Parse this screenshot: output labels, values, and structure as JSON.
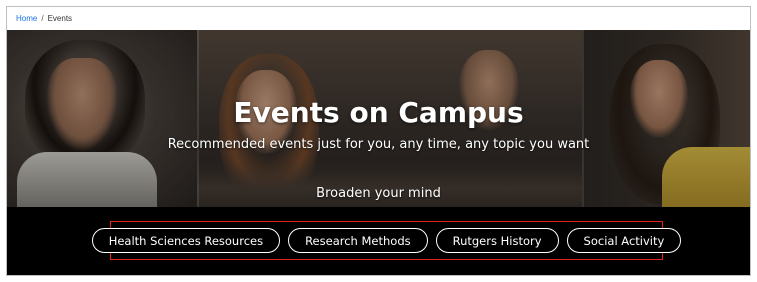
{
  "breadcrumb": {
    "home": "Home",
    "separator": "/",
    "current": "Events"
  },
  "hero": {
    "title": "Events on Campus",
    "subtitle": "Recommended events just for you, any time, any topic you want",
    "tagline": "Broaden your mind"
  },
  "topics": [
    {
      "label": "Health Sciences Resources"
    },
    {
      "label": "Research Methods"
    },
    {
      "label": "Rutgers History"
    },
    {
      "label": "Social Activity"
    }
  ],
  "colors": {
    "highlight_border": "#e0201c",
    "link": "#1a73e8",
    "band_background": "#000000",
    "pill_text": "#ffffff"
  }
}
